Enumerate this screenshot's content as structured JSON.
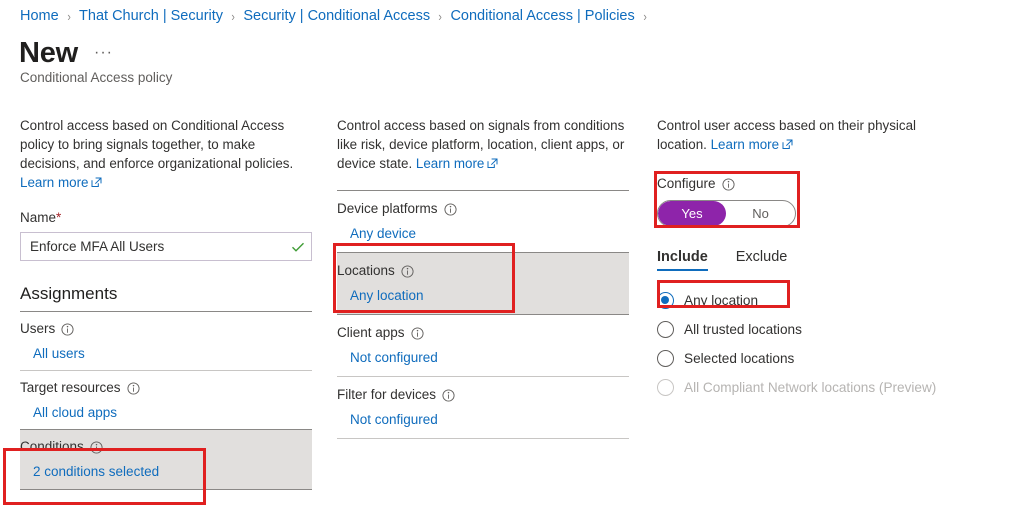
{
  "breadcrumb": {
    "separator": "›",
    "items": [
      "Home",
      "That Church | Security",
      "Security | Conditional Access",
      "Conditional Access | Policies"
    ]
  },
  "header": {
    "title": "New",
    "ellipsis": "···",
    "subtitle": "Conditional Access policy"
  },
  "policy_panel": {
    "blurb": "Control access based on Conditional Access policy to bring signals together, to make decisions, and enforce organizational policies.",
    "learn_more": "Learn more",
    "name_label": "Name",
    "name_required_mark": "*",
    "name_value": "Enforce MFA All Users",
    "name_valid_icon": "green-checkmark-icon",
    "assignments_heading": "Assignments",
    "rows": [
      {
        "label": "Users",
        "value": "All users",
        "highlighted": false
      },
      {
        "label": "Target resources",
        "value": "All cloud apps",
        "highlighted": false
      },
      {
        "label": "Conditions",
        "value": "2 conditions selected",
        "highlighted": true
      }
    ]
  },
  "conditions_panel": {
    "blurb_part1": "Control access based on signals from conditions like risk, device platform, location, client apps, or device state. ",
    "learn_more": "Learn more",
    "rows": [
      {
        "label": "Device platforms",
        "value": "Any device",
        "highlighted": false
      },
      {
        "label": "Locations",
        "value": "Any location",
        "highlighted": true
      },
      {
        "label": "Client apps",
        "value": "Not configured",
        "highlighted": false
      },
      {
        "label": "Filter for devices",
        "value": "Not configured",
        "highlighted": false
      }
    ]
  },
  "locations_panel": {
    "blurb_part1": "Control user access based on their physical location. ",
    "learn_more": "Learn more",
    "configure_label": "Configure",
    "toggle": {
      "yes_label": "Yes",
      "no_label": "No",
      "selected": "Yes",
      "on_color": "#8e24aa"
    },
    "tabs": [
      {
        "label": "Include",
        "active": true
      },
      {
        "label": "Exclude",
        "active": false
      }
    ],
    "radios": [
      {
        "label": "Any location",
        "checked": true,
        "disabled": false
      },
      {
        "label": "All trusted locations",
        "checked": false,
        "disabled": false
      },
      {
        "label": "Selected locations",
        "checked": false,
        "disabled": false
      },
      {
        "label": "All Compliant Network locations (Preview)",
        "checked": false,
        "disabled": true
      }
    ]
  },
  "annotations": {
    "color": "#e02020",
    "boxes": [
      "conditions-row-highlight",
      "locations-row-highlight",
      "configure-toggle-highlight",
      "any-location-radio-highlight"
    ]
  }
}
